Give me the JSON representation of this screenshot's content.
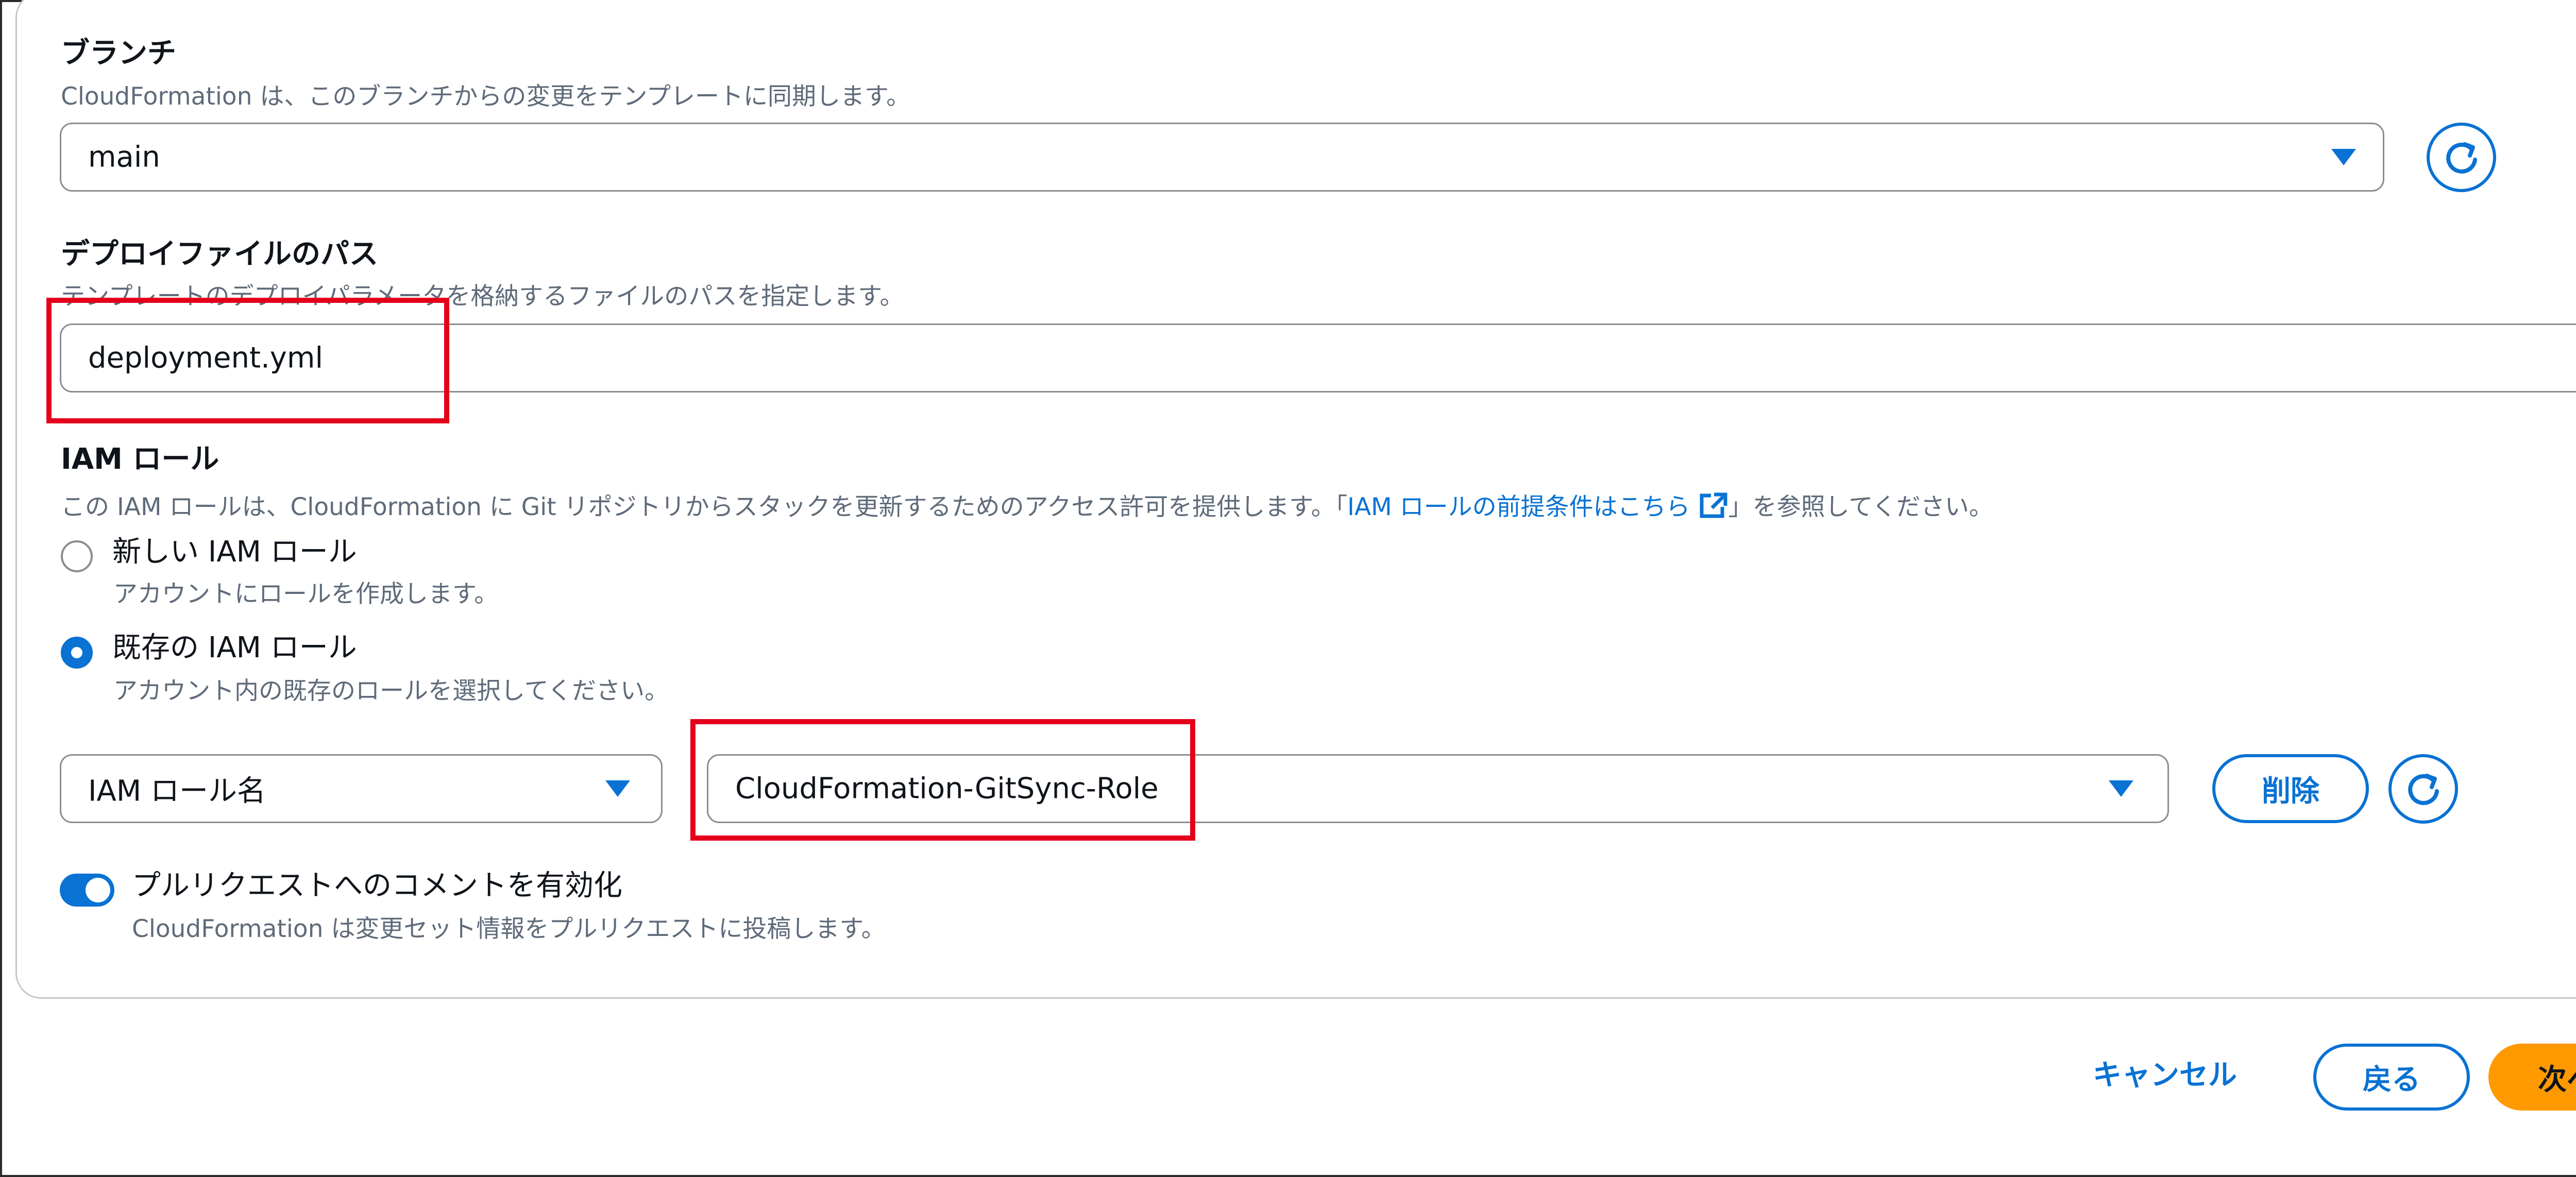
{
  "branch": {
    "label": "ブランチ",
    "description": "CloudFormation は、このブランチからの変更をテンプレートに同期します。",
    "value": "main"
  },
  "deploy_file": {
    "label": "デプロイファイルのパス",
    "description": "テンプレートのデプロイパラメータを格納するファイルのパスを指定します。",
    "value": "deployment.yml"
  },
  "iam_role": {
    "label": "IAM ロール",
    "description_before": "この IAM ロールは、CloudFormation に Git リポジトリからスタックを更新するためのアクセス許可を提供します。「",
    "link_text": "IAM ロールの前提条件はこちら",
    "description_after": "」を参照してください。",
    "options": [
      {
        "label": "新しい IAM ロール",
        "sub": "アカウントにロールを作成します。",
        "checked": false
      },
      {
        "label": "既存の IAM ロール",
        "sub": "アカウント内の既存のロールを選択してください。",
        "checked": true
      }
    ],
    "type_select": "IAM ロール名",
    "role_select": "CloudFormation-GitSync-Role",
    "remove_button": "削除"
  },
  "pr_comment": {
    "label": "プルリクエストへのコメントを有効化",
    "description": "CloudFormation は変更セット情報をプルリクエストに投稿します。",
    "enabled": true
  },
  "footer": {
    "cancel": "キャンセル",
    "back": "戻る",
    "next": "次へ"
  },
  "colors": {
    "accent": "#0972d3",
    "primary_button": "#ff9900",
    "highlight_box": "#e4001b"
  },
  "icons": {
    "refresh": "refresh-icon",
    "caret": "caret-down-icon",
    "external": "external-link-icon"
  }
}
